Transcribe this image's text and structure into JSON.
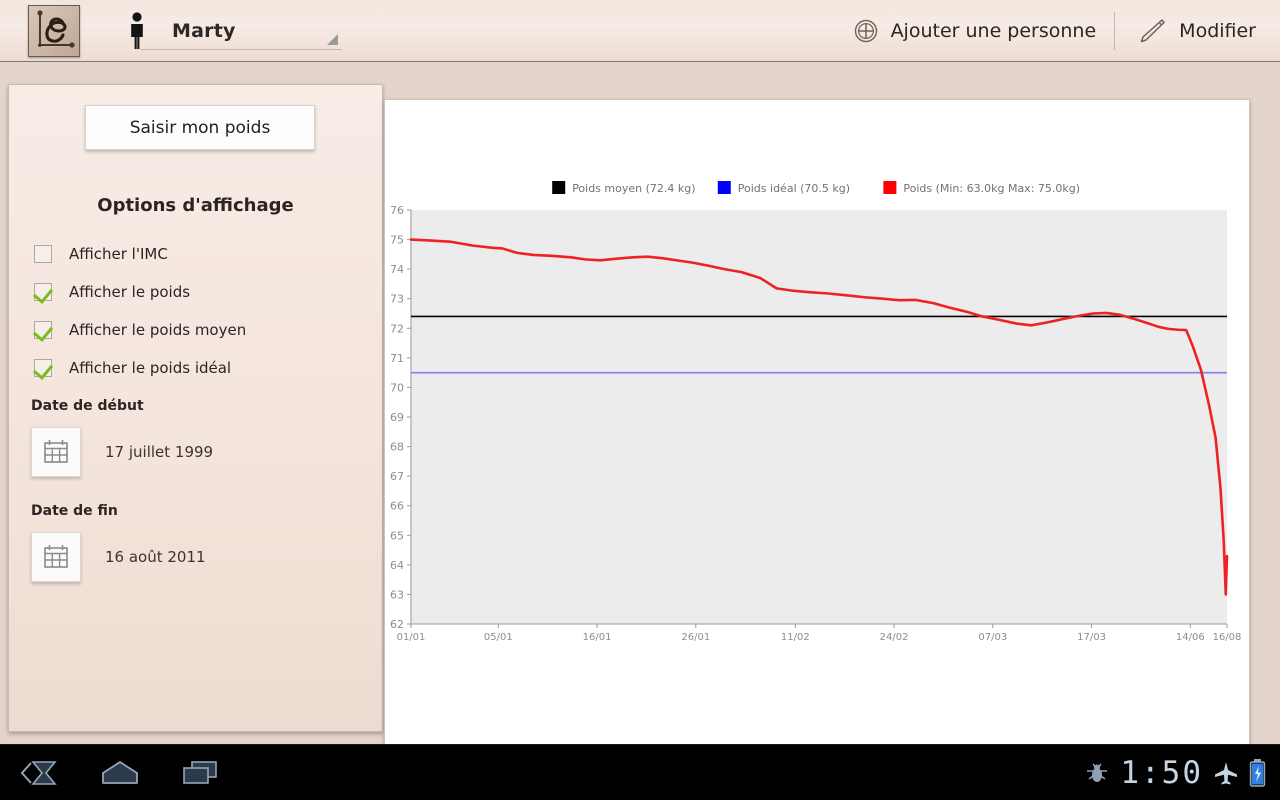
{
  "actionbar": {
    "logo_icon": "app-logo-curve-icon",
    "person_icon": "person-male-icon",
    "person_name": "Marty",
    "dropdown_icon": "dropdown-caret-icon",
    "add_person_icon": "plus-circle-icon",
    "add_person_label": "Ajouter une personne",
    "edit_icon": "pencil-icon",
    "edit_label": "Modifier"
  },
  "sidebar": {
    "weigh_button_label": "Saisir mon poids",
    "options_title": "Options d'affichage",
    "options": [
      {
        "label": "Afficher l'IMC",
        "checked": false
      },
      {
        "label": "Afficher le poids",
        "checked": true
      },
      {
        "label": "Afficher le poids moyen",
        "checked": true
      },
      {
        "label": "Afficher le poids idéal",
        "checked": true
      }
    ],
    "start_date": {
      "title": "Date de début",
      "value": "17 juillet 1999",
      "icon": "calendar-icon"
    },
    "end_date": {
      "title": "Date de fin",
      "value": "16 août 2011",
      "icon": "calendar-icon"
    }
  },
  "navbar": {
    "back_icon": "back-arrow-icon",
    "home_icon": "home-icon",
    "recents_icon": "recent-apps-icon",
    "debug_icon": "debug-bug-icon",
    "clock": "1:50",
    "airplane_icon": "airplane-mode-icon",
    "battery_icon": "battery-charging-icon"
  },
  "chart_data": {
    "type": "line",
    "title": "",
    "xlabel": "",
    "ylabel": "",
    "ylim": [
      62,
      76
    ],
    "yticks": [
      62,
      63,
      64,
      65,
      66,
      67,
      68,
      69,
      70,
      71,
      72,
      73,
      74,
      75,
      76
    ],
    "grid": false,
    "plot_bg": "#ececec",
    "legend_position": "top",
    "legend": [
      {
        "label": "Poids moyen (72.4 kg)",
        "color": "#000000"
      },
      {
        "label": "Poids idéal (70.5 kg)",
        "color": "#0000ff"
      },
      {
        "label": "Poids (Min: 63.0kg Max: 75.0kg)",
        "color": "#ff0000"
      }
    ],
    "xticks": [
      {
        "label": "01/01",
        "pos": 0.0
      },
      {
        "label": "05/01",
        "pos": 0.107
      },
      {
        "label": "16/01",
        "pos": 0.228
      },
      {
        "label": "26/01",
        "pos": 0.349
      },
      {
        "label": "11/02",
        "pos": 0.471
      },
      {
        "label": "24/02",
        "pos": 0.592
      },
      {
        "label": "07/03",
        "pos": 0.713
      },
      {
        "label": "17/03",
        "pos": 0.834
      },
      {
        "label": "14/06",
        "pos": 0.955
      },
      {
        "label": "16/08",
        "pos": 1.0
      }
    ],
    "series": [
      {
        "name": "Poids moyen",
        "color": "#000000",
        "type": "hline",
        "value": 72.4
      },
      {
        "name": "Poids idéal",
        "color": "#8080f0",
        "type": "hline",
        "value": 70.5
      },
      {
        "name": "Poids",
        "color": "#ee2222",
        "type": "line",
        "min": 63.0,
        "max": 75.0,
        "points": [
          [
            0.0,
            75.0
          ],
          [
            0.022,
            74.97
          ],
          [
            0.048,
            74.93
          ],
          [
            0.075,
            74.8
          ],
          [
            0.1,
            74.72
          ],
          [
            0.112,
            74.7
          ],
          [
            0.13,
            74.55
          ],
          [
            0.15,
            74.48
          ],
          [
            0.172,
            74.45
          ],
          [
            0.196,
            74.4
          ],
          [
            0.213,
            74.33
          ],
          [
            0.232,
            74.3
          ],
          [
            0.25,
            74.35
          ],
          [
            0.272,
            74.4
          ],
          [
            0.29,
            74.42
          ],
          [
            0.308,
            74.37
          ],
          [
            0.325,
            74.3
          ],
          [
            0.345,
            74.22
          ],
          [
            0.364,
            74.12
          ],
          [
            0.384,
            74.0
          ],
          [
            0.405,
            73.9
          ],
          [
            0.428,
            73.7
          ],
          [
            0.448,
            73.35
          ],
          [
            0.468,
            73.27
          ],
          [
            0.488,
            73.22
          ],
          [
            0.51,
            73.18
          ],
          [
            0.532,
            73.12
          ],
          [
            0.556,
            73.05
          ],
          [
            0.578,
            73.0
          ],
          [
            0.598,
            72.95
          ],
          [
            0.618,
            72.96
          ],
          [
            0.64,
            72.85
          ],
          [
            0.66,
            72.7
          ],
          [
            0.682,
            72.55
          ],
          [
            0.7,
            72.4
          ],
          [
            0.722,
            72.28
          ],
          [
            0.742,
            72.16
          ],
          [
            0.76,
            72.1
          ],
          [
            0.78,
            72.2
          ],
          [
            0.8,
            72.32
          ],
          [
            0.818,
            72.42
          ],
          [
            0.836,
            72.5
          ],
          [
            0.852,
            72.52
          ],
          [
            0.868,
            72.46
          ],
          [
            0.886,
            72.32
          ],
          [
            0.902,
            72.18
          ],
          [
            0.916,
            72.05
          ],
          [
            0.928,
            71.98
          ],
          [
            0.94,
            71.95
          ],
          [
            0.95,
            71.94
          ],
          [
            0.958,
            71.4
          ],
          [
            0.968,
            70.6
          ],
          [
            0.978,
            69.4
          ],
          [
            0.986,
            68.3
          ],
          [
            0.992,
            66.6
          ],
          [
            0.996,
            64.8
          ],
          [
            0.9985,
            63.0
          ],
          [
            1.0,
            64.3
          ]
        ]
      }
    ]
  }
}
